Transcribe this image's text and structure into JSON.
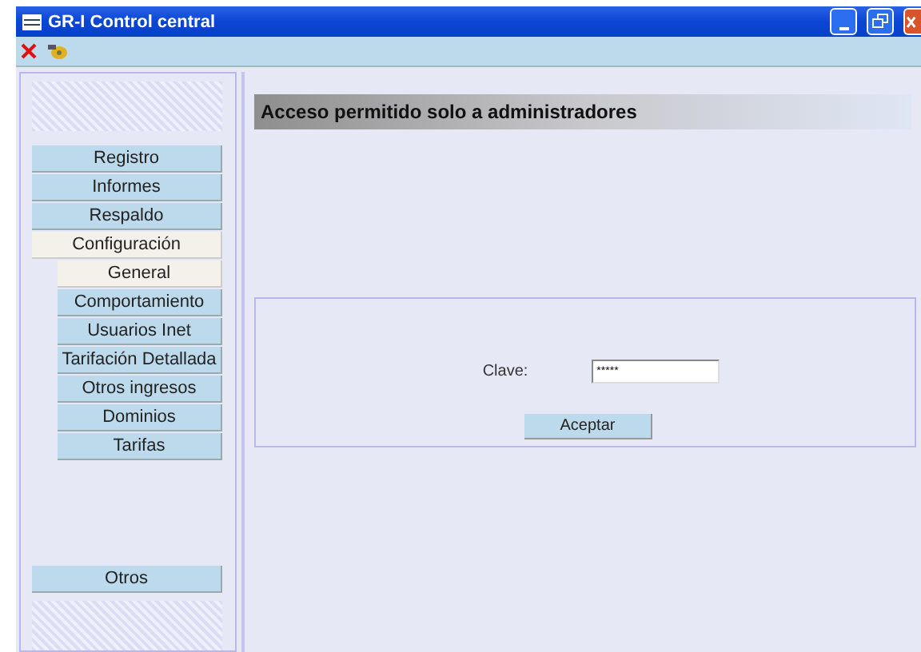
{
  "window": {
    "title": "GR-I Control central"
  },
  "toolbar": [
    {
      "kind": "close"
    },
    {
      "kind": "tools"
    }
  ],
  "sidebar": {
    "items": [
      {
        "label": "Registro",
        "selected": false
      },
      {
        "label": "Informes",
        "selected": false
      },
      {
        "label": "Respaldo",
        "selected": false
      },
      {
        "label": "Configuración",
        "selected": true,
        "children": [
          {
            "label": "General",
            "selected": true
          },
          {
            "label": "Comportamiento",
            "selected": false
          },
          {
            "label": "Usuarios Inet",
            "selected": false
          },
          {
            "label": "Tarifación Detallada",
            "selected": false
          },
          {
            "label": "Otros ingresos",
            "selected": false
          },
          {
            "label": "Dominios",
            "selected": false
          },
          {
            "label": "Tarifas",
            "selected": false
          }
        ]
      }
    ],
    "bottom_item": {
      "label": "Otros",
      "selected": false
    }
  },
  "content": {
    "header": "Acceso permitido solo a administradores",
    "form": {
      "label": "Clave:",
      "value": "*****",
      "button": "Aceptar"
    }
  }
}
